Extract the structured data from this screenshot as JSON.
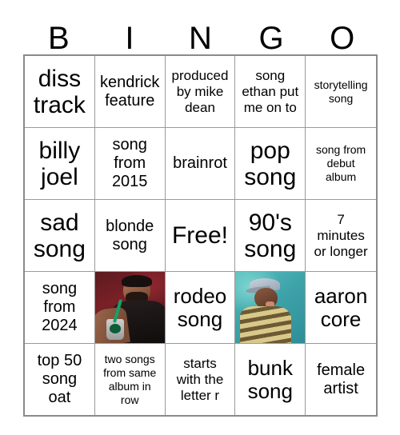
{
  "card": {
    "title": "BINGO",
    "header_letters": [
      "B",
      "I",
      "N",
      "G",
      "O"
    ],
    "free_space_label": "Free!",
    "colors": {
      "background": "#ffffff",
      "text": "#000000",
      "outer_border": "#8a8a8a",
      "inner_gridline": "#9a9a9a",
      "photo_a_background": "#7a2027",
      "photo_b_background": "#3fa3aa"
    },
    "grid": {
      "rows": 5,
      "columns": 5,
      "cells": [
        [
          {
            "text": "diss\ntrack",
            "size": "t-xl",
            "type": "text"
          },
          {
            "text": "kendrick\nfeature",
            "size": "t-md",
            "type": "text"
          },
          {
            "text": "produced\nby mike\ndean",
            "size": "t-sm",
            "type": "text"
          },
          {
            "text": "song\nethan put\nme on to",
            "size": "t-sm",
            "type": "text"
          },
          {
            "text": "storytelling\nsong",
            "size": "t-xs",
            "type": "text"
          }
        ],
        [
          {
            "text": "billy\njoel",
            "size": "t-xl",
            "type": "text"
          },
          {
            "text": "song\nfrom\n2015",
            "size": "t-md",
            "type": "text"
          },
          {
            "text": "brainrot",
            "size": "t-md",
            "type": "text"
          },
          {
            "text": "pop\nsong",
            "size": "t-xl",
            "type": "text"
          },
          {
            "text": "song from\ndebut\nalbum",
            "size": "t-xs",
            "type": "text"
          }
        ],
        [
          {
            "text": "sad\nsong",
            "size": "t-xl",
            "type": "text"
          },
          {
            "text": "blonde\nsong",
            "size": "t-md",
            "type": "text"
          },
          {
            "text": "Free!",
            "size": "t-xl",
            "type": "free"
          },
          {
            "text": "90's\nsong",
            "size": "t-xl",
            "type": "text"
          },
          {
            "text": "7\nminutes\nor longer",
            "size": "t-sm",
            "type": "text"
          }
        ],
        [
          {
            "text": "song\nfrom\n2024",
            "size": "t-md",
            "type": "text"
          },
          {
            "text": "",
            "size": "t-md",
            "type": "photo",
            "photo": "photo-a",
            "alt": "photo of man in black hoodie drinking from a cup with a green straw on a dark red background"
          },
          {
            "text": "rodeo\nsong",
            "size": "t-lg",
            "type": "text"
          },
          {
            "text": "",
            "size": "t-md",
            "type": "photo",
            "photo": "photo-b",
            "alt": "photo of person in a light blue cap and yellow striped shirt on a teal background"
          },
          {
            "text": "aaron\ncore",
            "size": "t-lg",
            "type": "text"
          }
        ],
        [
          {
            "text": "top 50\nsong\noat",
            "size": "t-md",
            "type": "text"
          },
          {
            "text": "two songs\nfrom same\nalbum in\nrow",
            "size": "t-xs",
            "type": "text"
          },
          {
            "text": "starts\nwith the\nletter r",
            "size": "t-sm",
            "type": "text"
          },
          {
            "text": "bunk\nsong",
            "size": "t-lg",
            "type": "text"
          },
          {
            "text": "female\nartist",
            "size": "t-md",
            "type": "text"
          }
        ]
      ]
    }
  }
}
